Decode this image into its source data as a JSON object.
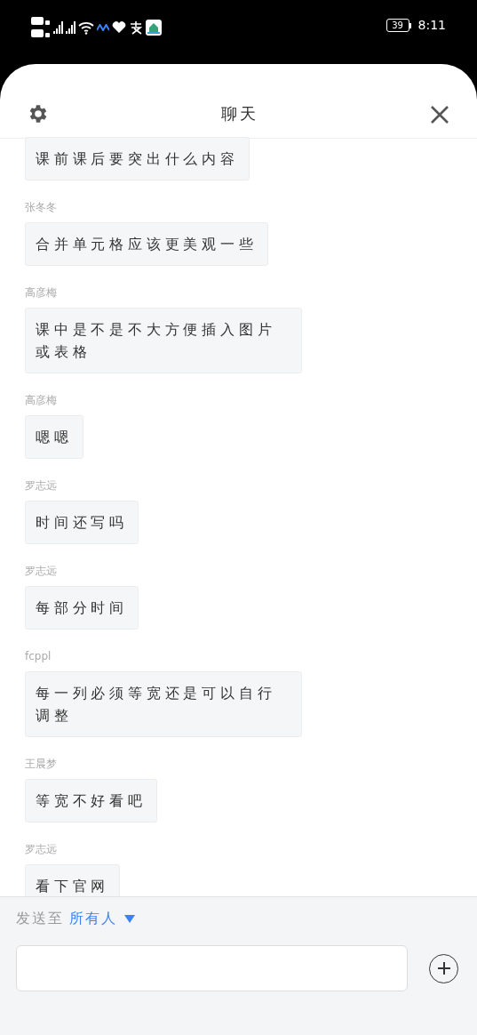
{
  "status_bar": {
    "battery": "39",
    "time": "8:11"
  },
  "header": {
    "title": "聊天"
  },
  "messages": [
    {
      "text": "课前课后要突出什么内容"
    },
    {
      "sender": "张冬冬",
      "text": "合并单元格应该更美观一些"
    },
    {
      "sender": "高彦梅",
      "text": "课中是不是不大方便插入图片或表格"
    },
    {
      "sender": "高彦梅",
      "text": "嗯嗯"
    },
    {
      "sender": "罗志远",
      "text": "时间还写吗"
    },
    {
      "sender": "罗志远",
      "text": "每部分时间"
    },
    {
      "sender": "fcppl",
      "text": "每一列必须等宽还是可以自行调整"
    },
    {
      "sender": "王晨梦",
      "text": "等宽不好看吧"
    },
    {
      "sender": "罗志远",
      "text": "看下官网"
    }
  ],
  "composer": {
    "send_to_label": "发送至",
    "recipient": "所有人"
  }
}
